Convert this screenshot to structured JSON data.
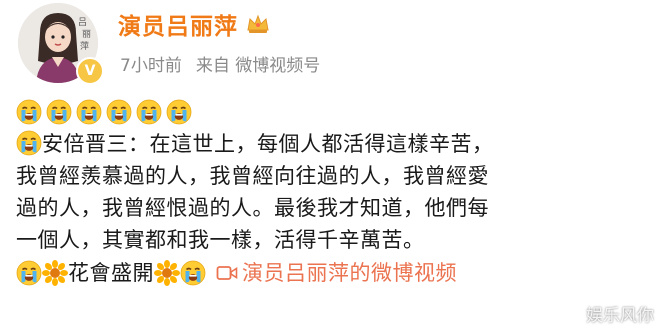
{
  "post": {
    "author_name": "演员吕丽萍",
    "time": "7小时前",
    "source": "来自 微博视频号",
    "icons": {
      "avatar": "avatar-illustration",
      "verified": "verified-v-icon",
      "crown": "crown-icon",
      "cry": "loudly-crying-emoji",
      "flower": "sunflower-emoji",
      "video": "video-camera-icon"
    },
    "lines": [
      "安倍晋三：在這世上，每個人都活得這樣辛苦，",
      "我曾經羨慕過的人，我曾經向往過的人，我曾經愛",
      "過的人，我曾經恨過的人。最後我才知道，他們每",
      "一個人，其實都和我一樣，活得千辛萬苦。"
    ],
    "flower_text": "花會盛開",
    "video_link": "演员吕丽萍的微博视频",
    "watermark": "娱乐风你",
    "colors": {
      "name": "#f07a16",
      "link": "#eb7350",
      "meta": "#8a8a8a"
    }
  }
}
